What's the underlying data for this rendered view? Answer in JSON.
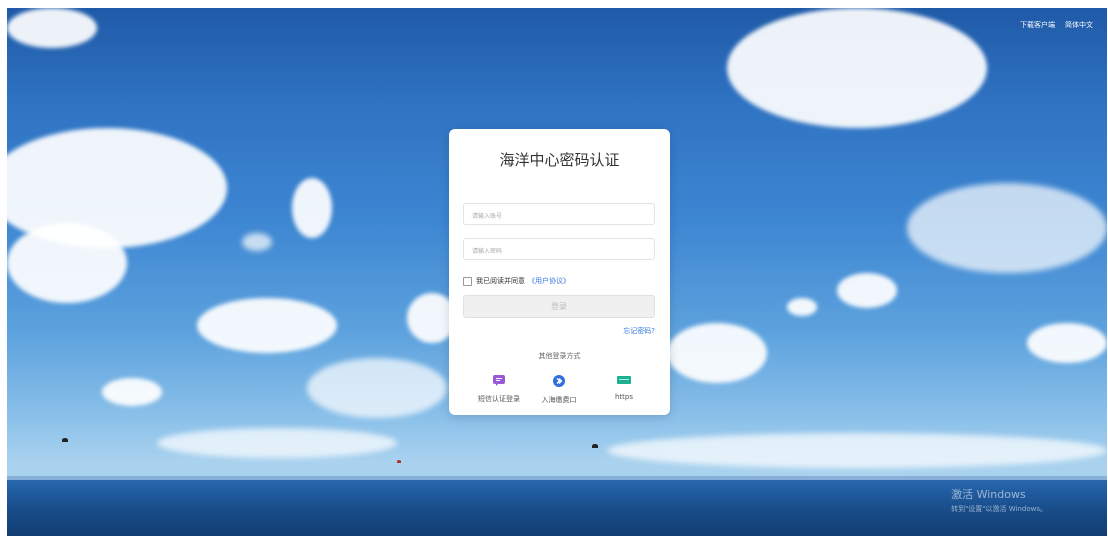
{
  "header": {
    "download_client": "下载客户端",
    "language": "简体中文"
  },
  "login": {
    "title": "海洋中心密码认证",
    "account_placeholder": "请输入账号",
    "password_placeholder": "请输入密码",
    "agree_text": "我已阅读并同意",
    "agreement_link": "《用户协议》",
    "login_button": "登录",
    "forgot_password": "忘记密码?",
    "other_methods_label": "其他登录方式",
    "methods": [
      {
        "label": "短信认证登录",
        "icon": "sms-icon",
        "color": "#9b59d6"
      },
      {
        "label": "入海缴费口",
        "icon": "portal-icon",
        "color": "#2f6fe0"
      },
      {
        "label": "https",
        "icon": "https-icon",
        "color": "#19b394"
      }
    ]
  },
  "watermark": {
    "line1": "激活 Windows",
    "line2": "转到\"设置\"以激活 Windows。"
  },
  "colors": {
    "link": "#3a7be0",
    "button_disabled": "#f0f0f0"
  }
}
